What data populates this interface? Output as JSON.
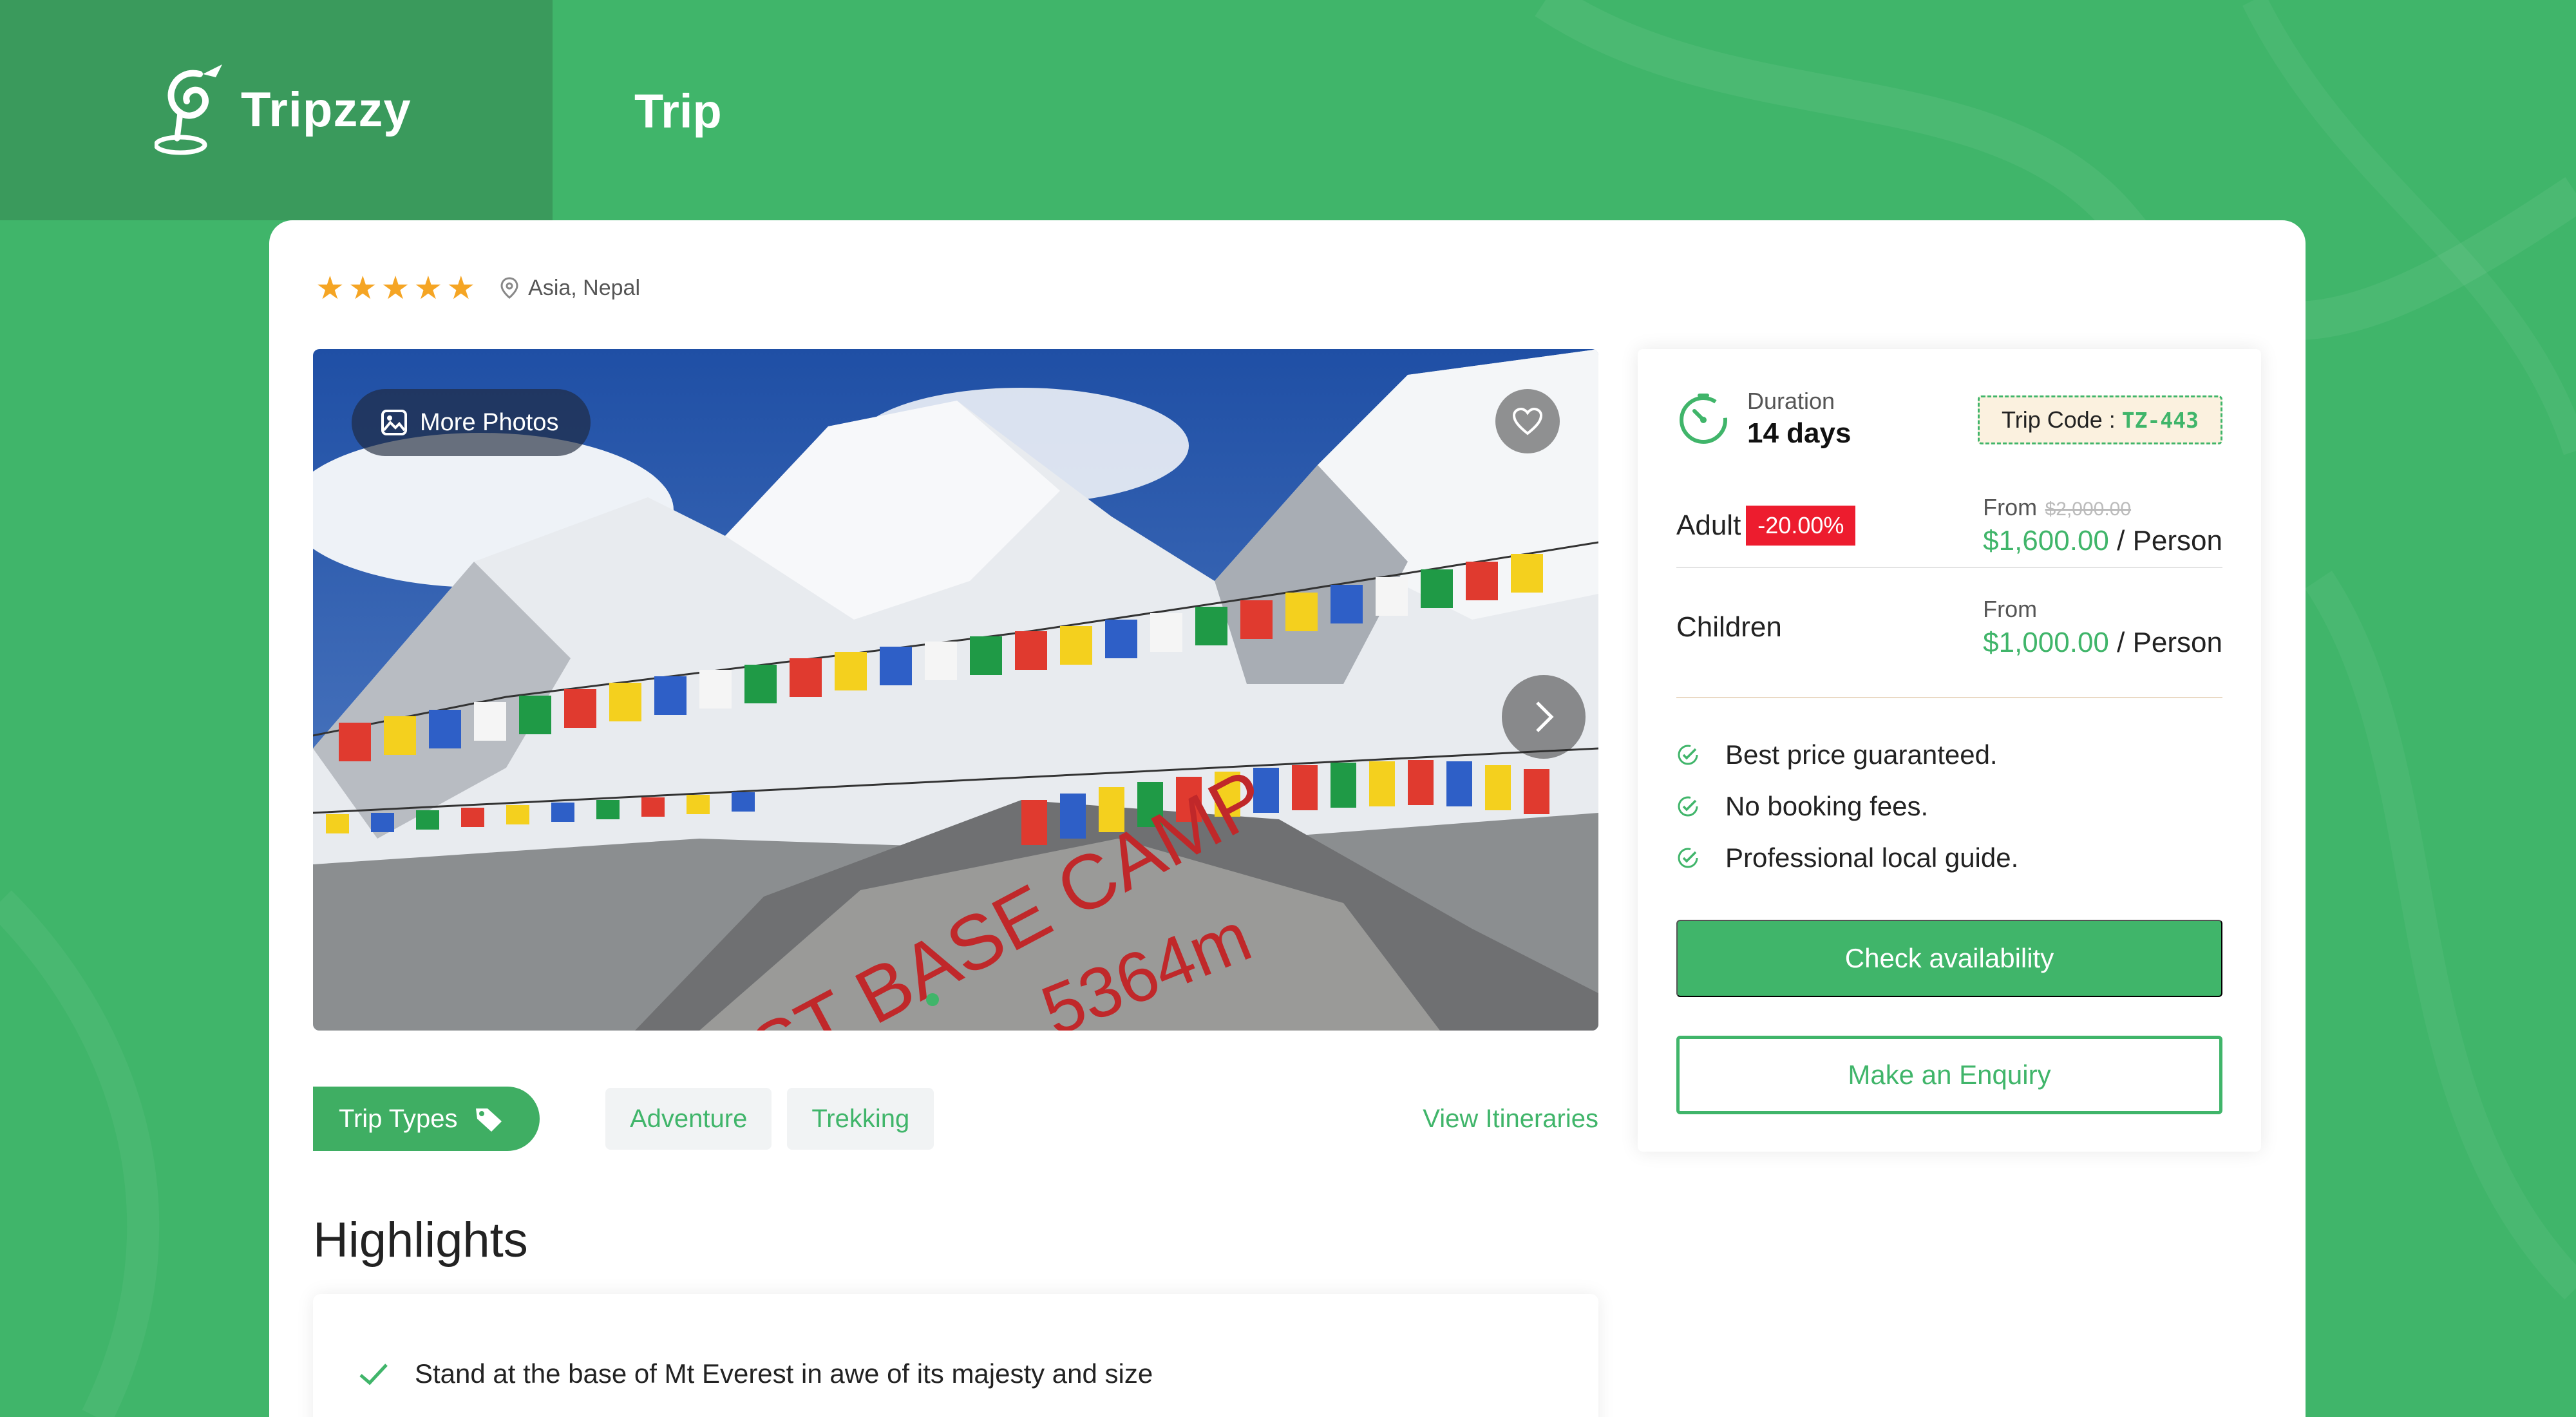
{
  "brand": {
    "name": "Tripzzy"
  },
  "header": {
    "title": "Trip"
  },
  "trip": {
    "rating": 5,
    "location": "Asia, Nepal",
    "gallery": {
      "more_photos_label": "More Photos",
      "photo_text": "EST BASE CAMP",
      "photo_text_2": "5364m"
    },
    "types_label": "Trip Types",
    "types": [
      "Adventure",
      "Trekking"
    ],
    "view_itineraries": "View Itineraries"
  },
  "highlights": {
    "title": "Highlights",
    "items": [
      "Stand at the base of Mt Everest in awe of its majesty and size"
    ]
  },
  "booking": {
    "duration_label": "Duration",
    "duration_value": "14 days",
    "trip_code_label": "Trip Code :",
    "trip_code": "TZ-443",
    "adult": {
      "label": "Adult",
      "discount": "-20.00%",
      "from": "From",
      "original": "$2,000.00",
      "price": "$1,600.00",
      "per": "/ Person"
    },
    "children": {
      "label": "Children",
      "from": "From",
      "price": "$1,000.00",
      "per": "/ Person"
    },
    "features": [
      "Best price guaranteed.",
      "No booking fees.",
      "Professional local guide."
    ],
    "check_availability": "Check availability",
    "make_enquiry": "Make an Enquiry"
  },
  "colors": {
    "brand_green": "#40b56a",
    "discount_red": "#ed1c2e",
    "star": "#f5a524"
  },
  "icons": [
    "tripzzy-logo-icon",
    "star-icon",
    "location-pin-icon",
    "image-icon",
    "heart-icon",
    "chevron-right-icon",
    "tag-icon",
    "check-icon",
    "timer-icon",
    "check-circle-icon"
  ]
}
